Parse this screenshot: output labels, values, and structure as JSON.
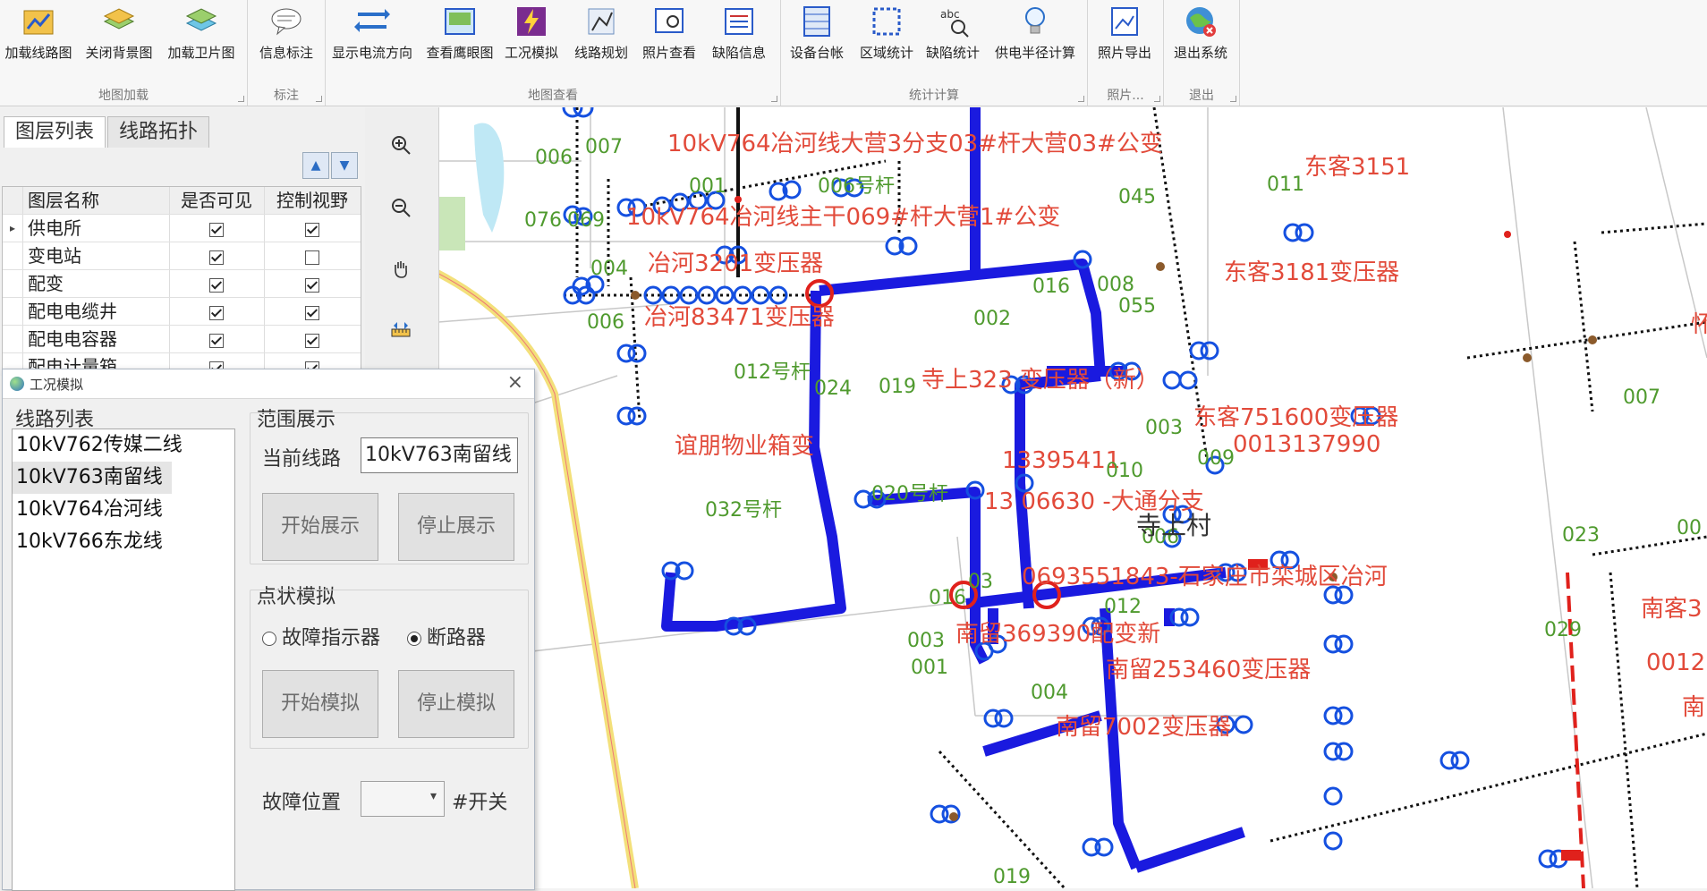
{
  "ribbon": {
    "groups": [
      {
        "label": "地图加载",
        "buttons": [
          "加载线路图",
          "关闭背景图",
          "加载卫片图"
        ]
      },
      {
        "label": "标注",
        "buttons": [
          "信息标注"
        ]
      },
      {
        "label": "地图查看",
        "buttons": [
          "显示电流方向",
          "查看鹰眼图",
          "工况模拟",
          "线路规划",
          "照片查看",
          "缺陷信息"
        ]
      },
      {
        "label": "统计计算",
        "buttons": [
          "设备台帐",
          "区域统计",
          "缺陷统计",
          "供电半径计算"
        ]
      },
      {
        "label": "照片...",
        "buttons": [
          "照片导出"
        ]
      },
      {
        "label": "退出",
        "buttons": [
          "退出系统"
        ]
      }
    ]
  },
  "layer_panel": {
    "tabs": [
      "图层列表",
      "线路拓扑"
    ],
    "columns": [
      "图层名称",
      "是否可见",
      "控制视野"
    ],
    "rows": [
      {
        "name": "供电所",
        "visible": true,
        "view": true,
        "current": true
      },
      {
        "name": "变电站",
        "visible": true,
        "view": false
      },
      {
        "name": "配变",
        "visible": true,
        "view": true
      },
      {
        "name": "配电电缆井",
        "visible": true,
        "view": true
      },
      {
        "name": "配电电容器",
        "visible": true,
        "view": true
      },
      {
        "name": "配电计量箱",
        "visible": true,
        "view": true
      }
    ]
  },
  "dialog": {
    "title": "工况模拟",
    "line_list_title": "线路列表",
    "lines": [
      "10kV762传媒二线",
      "10kV763南留线",
      "10kV764冶河线",
      "10kV766东龙线"
    ],
    "selected_line_index": 1,
    "range_section": {
      "title": "范围展示",
      "current_line_label": "当前线路",
      "current_line_value": "10kV763南留线",
      "start_button": "开始展示",
      "stop_button": "停止展示"
    },
    "point_section": {
      "title": "点状模拟",
      "radio_fault": "故障指示器",
      "radio_breaker": "断路器",
      "selected": "断路器",
      "start_button": "开始模拟",
      "stop_button": "停止模拟"
    },
    "fault_position_label": "故障位置",
    "fault_position_value": "",
    "switch_suffix": "#开关"
  },
  "map": {
    "red_labels": [
      "10kV764冶河线大营3分支03#杆大营03#公变",
      "10kV764冶河线主干069#杆大营1#公变",
      "冶河3201变压器",
      "冶河83471变压器",
      "寺上323 变压器（新）",
      "谊朋物业箱变",
      "13395411",
      "13 06630 -大通分支",
      "0693551843-石家庄市栾城区冶河",
      "南留369390配变新",
      "南留253460变压器",
      "南留7002变压器",
      "东客3151",
      "东客3181变压器",
      "东客751600变压器",
      "0013137990",
      "怀",
      "南客3",
      "0012",
      "南"
    ],
    "green_labels": [
      "006",
      "007",
      "001",
      "006号杆",
      "045",
      "011",
      "076",
      "069",
      "004",
      "006",
      "016",
      "008",
      "055",
      "002",
      "012号杆",
      "024",
      "019",
      "003",
      "009",
      "010",
      "032号杆",
      "020号杆",
      "03",
      "006",
      "016",
      "012",
      "003",
      "001",
      "004",
      "029",
      "023",
      "007",
      "00",
      "019"
    ],
    "village_label": "寺上村",
    "colors": {
      "highlight_line": "#1a1adf",
      "label_red": "#e24a3a",
      "label_green": "#4f9a2e",
      "road": "#f3e07a"
    }
  }
}
